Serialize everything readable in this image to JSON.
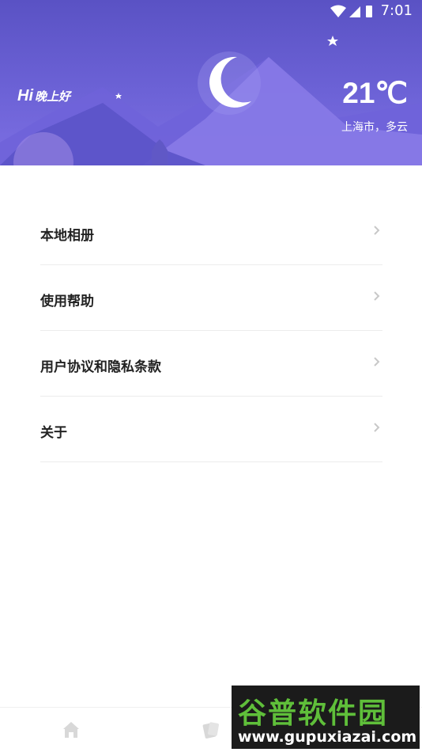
{
  "status_bar": {
    "time": "7:01"
  },
  "header": {
    "greeting_hi": "Hi",
    "greeting_text": "晚上好",
    "temperature": "21℃",
    "location_weather": "上海市，多云"
  },
  "menu": {
    "items": [
      {
        "label": "本地相册"
      },
      {
        "label": "使用帮助"
      },
      {
        "label": "用户协议和隐私条款"
      },
      {
        "label": "关于"
      }
    ]
  },
  "bottom_nav": {
    "items": [
      {
        "icon": "home-icon"
      },
      {
        "icon": "cards-icon"
      },
      {
        "icon": "profile-icon"
      }
    ]
  },
  "watermark": {
    "brand": "谷普软件园",
    "url": "www.gupuxiazai.com"
  }
}
